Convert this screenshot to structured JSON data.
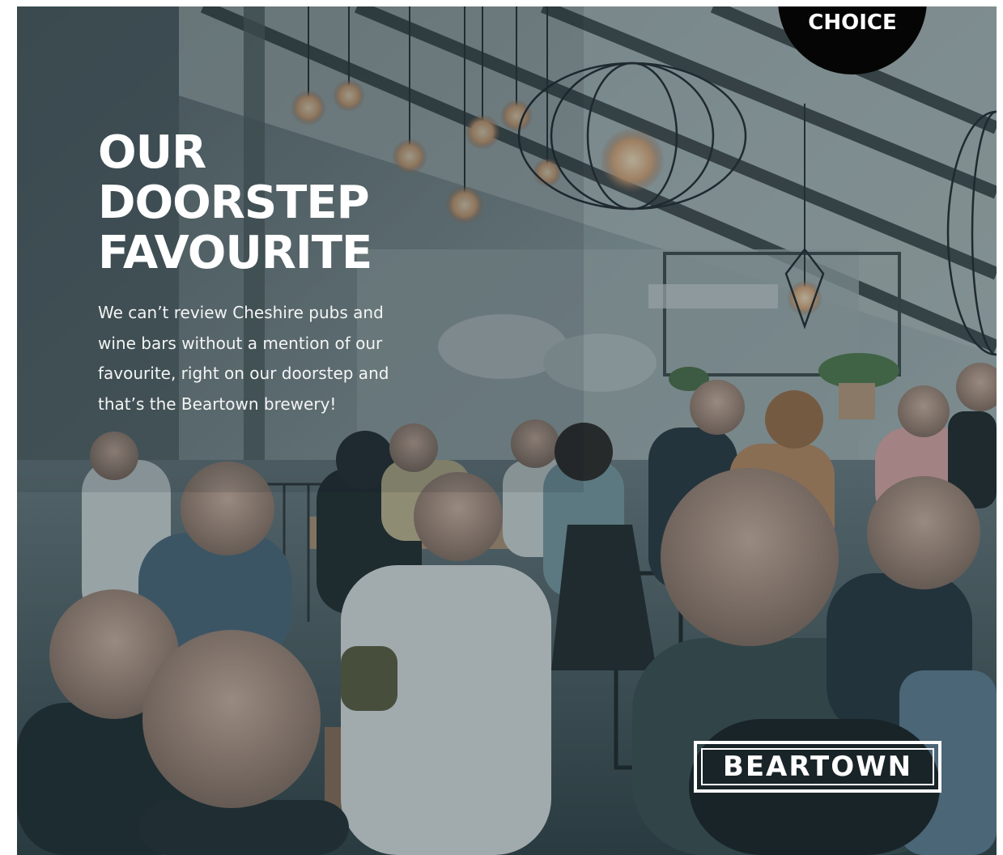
{
  "badge": {
    "label": "CHOICE"
  },
  "headline": {
    "lines": [
      "OUR",
      "DOORSTEP",
      "FAVOURITE"
    ]
  },
  "intro": {
    "lines": [
      "We can’t review Cheshire pubs and",
      "wine bars without a mention of our",
      "favourite, right on our doorstep and",
      "that’s the Beartown brewery!"
    ]
  },
  "logo": {
    "text": "BEARTOWN"
  },
  "photo": {
    "subject": "crowd-in-brewery-taproom",
    "icon": "photo-icon"
  },
  "colors": {
    "badge": "#050505",
    "text": "#ffffff",
    "photo_tint": "#6e8186"
  }
}
